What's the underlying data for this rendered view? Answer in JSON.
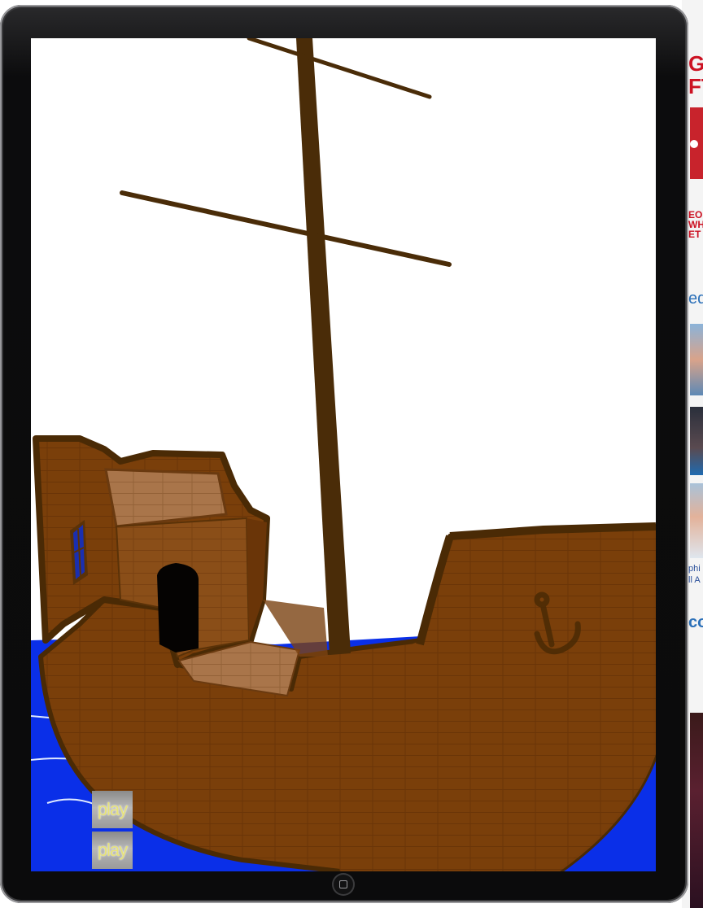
{
  "background_page": {
    "headline_fragment": "G\nFT",
    "small_headline_fragment": "EO\nWHO\nET",
    "blue_link_fragment": "ed",
    "caption_fragment": "phi\nll A",
    "blue_link_fragment_2": "co"
  },
  "game": {
    "scene_name": "pirate ship",
    "colors": {
      "sea": "#0a2fe8",
      "hull": "#7a3f0a",
      "hull_dark": "#4a2a05",
      "mast": "#4a2c08",
      "deck": "#a9754a",
      "sky": "#ffffff"
    },
    "buttons": {
      "play_1": "play",
      "play_2": "play"
    }
  },
  "device": {
    "home_button_icon": "home-square-icon"
  }
}
